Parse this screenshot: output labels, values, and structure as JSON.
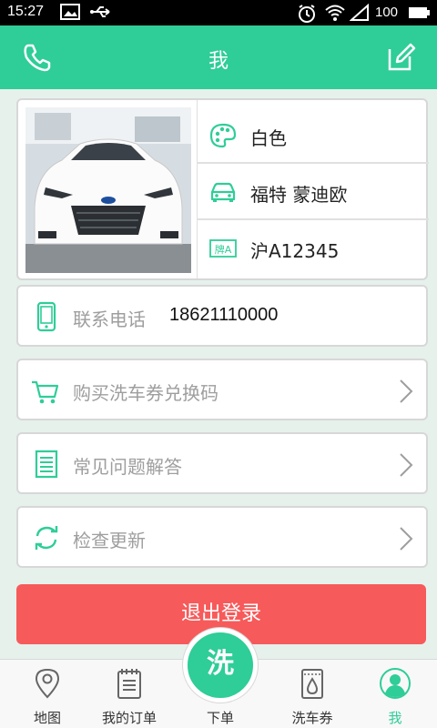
{
  "status_bar": {
    "time": "15:27",
    "battery": "100",
    "icons": [
      "image-icon",
      "usb-icon",
      "alarm-icon",
      "wifi-icon",
      "signal-icon",
      "battery-icon"
    ]
  },
  "header": {
    "title": "我",
    "left_icon": "phone-icon",
    "right_icon": "edit-icon",
    "accent": "#2fcd98"
  },
  "car": {
    "color": "白色",
    "model": "福特 蒙迪欧",
    "plate": "沪A12345",
    "plate_icon_text": "牌A"
  },
  "contact": {
    "label": "联系电话",
    "value": "18621110000"
  },
  "menu": [
    {
      "label": "购买洗车券兑换码",
      "icon": "cart-icon"
    },
    {
      "label": "常见问题解答",
      "icon": "document-icon"
    },
    {
      "label": "检查更新",
      "icon": "refresh-icon"
    }
  ],
  "logout_label": "退出登录",
  "logout_color": "#f75a5a",
  "tabs": [
    {
      "label": "地图",
      "icon": "map-pin-icon"
    },
    {
      "label": "我的订单",
      "icon": "notepad-icon"
    },
    {
      "label": "下单",
      "icon": "wash-icon"
    },
    {
      "label": "洗车券",
      "icon": "coupon-icon"
    },
    {
      "label": "我",
      "icon": "user-icon",
      "active": true
    }
  ],
  "wash_button_label": "洗"
}
